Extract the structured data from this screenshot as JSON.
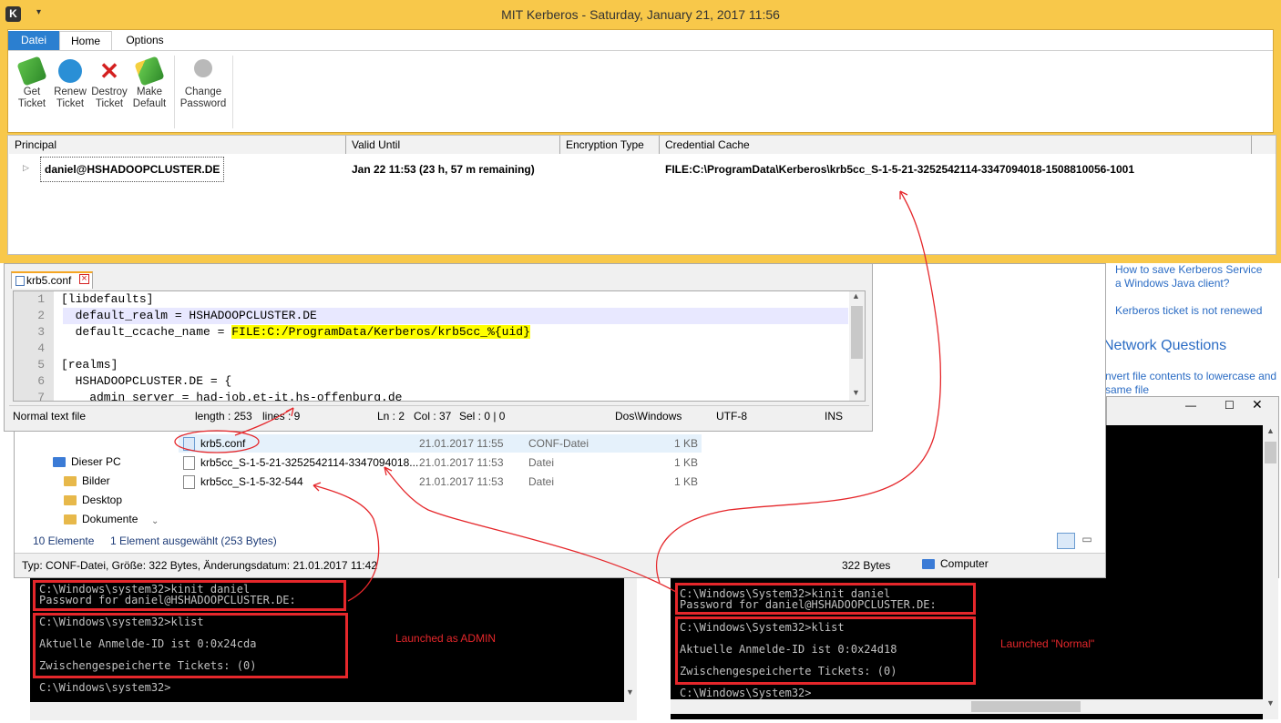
{
  "kerberos": {
    "title": "MIT Kerberos - Saturday, January 21, 2017  11:56",
    "tabs": [
      "Datei",
      "Home",
      "Options"
    ],
    "buttons": [
      {
        "label1": "Get",
        "label2": "Ticket",
        "icon": "green-ticket-icon"
      },
      {
        "label1": "Renew",
        "label2": "Ticket",
        "icon": "renew-icon"
      },
      {
        "label1": "Destroy",
        "label2": "Ticket",
        "icon": "red-x-icon"
      },
      {
        "label1": "Make",
        "label2": "Default",
        "icon": "star-ticket-icon"
      },
      {
        "label1": "Change",
        "label2": "Password",
        "icon": "keys-icon"
      }
    ],
    "columns": [
      "Principal",
      "Valid Until",
      "Encryption Type",
      "Credential Cache"
    ],
    "row": {
      "principal": "daniel@HSHADOOPCLUSTER.DE",
      "valid_until": "Jan 22  11:53 (23 h, 57 m remaining)",
      "encryption_type": "",
      "credential_cache": "FILE:C:\\ProgramData\\Kerberos\\krb5cc_S-1-5-21-3252542114-3347094018-1508810056-1001"
    }
  },
  "side_links": {
    "link1a": "How to save Kerberos Service",
    "link1b": "a Windows Java client?",
    "link2": "Kerberos ticket is not renewed",
    "heading": "Network Questions",
    "link3a": "nvert file contents to lowercase and",
    "link3b": "same file"
  },
  "notepad": {
    "tab": "krb5.conf",
    "lines": [
      {
        "no": "1",
        "text": "[libdefaults]"
      },
      {
        "no": "2",
        "text": "  default_realm = HSHADOOPCLUSTER.DE"
      },
      {
        "no": "3",
        "text": "  default_ccache_name = ",
        "hl": "FILE:C:/ProgramData/Kerberos/krb5cc_%{uid}"
      },
      {
        "no": "4",
        "text": ""
      },
      {
        "no": "5",
        "text": "[realms]"
      },
      {
        "no": "6",
        "text": "  HSHADOOPCLUSTER.DE = {"
      },
      {
        "no": "7",
        "text": "    admin_server = had-job.et-it.hs-offenburg.de"
      }
    ],
    "status": {
      "type": "Normal text file",
      "length": "length : 253",
      "lines": "lines : 9",
      "ln": "Ln : 2",
      "col": "Col : 37",
      "sel": "Sel : 0 | 0",
      "eol": "Dos\\Windows",
      "enc": "UTF-8",
      "ins": "INS"
    }
  },
  "explorer": {
    "tree": [
      "Dieser PC",
      "Bilder",
      "Desktop",
      "Dokumente"
    ],
    "files": [
      {
        "name": "krb5.conf",
        "date": "21.01.2017 11:55",
        "type": "CONF-Datei",
        "size": "1 KB"
      },
      {
        "name": "krb5cc_S-1-5-21-3252542114-3347094018...",
        "date": "21.01.2017 11:53",
        "type": "Datei",
        "size": "1 KB"
      },
      {
        "name": "krb5cc_S-1-5-32-544",
        "date": "21.01.2017 11:53",
        "type": "Datei",
        "size": "1 KB"
      }
    ],
    "count": "10 Elemente",
    "selected": "1 Element ausgewählt (253 Bytes)",
    "statusbar": "Typ: CONF-Datei, Größe: 322 Bytes, Änderungsdatum: 21.01.2017 11:42",
    "bytes": "322 Bytes",
    "computer": "Computer"
  },
  "console_admin": {
    "l1": "C:\\Windows\\system32>kinit daniel",
    "l2": "Password for daniel@HSHADOOPCLUSTER.DE:",
    "l3": "C:\\Windows\\system32>klist",
    "l4": "Aktuelle Anmelde-ID ist 0:0x24cda",
    "l5": "Zwischengespeicherte Tickets: (0)",
    "l6": "C:\\Windows\\system32>",
    "annotation": "Launched as ADMIN"
  },
  "console_normal": {
    "l1": "C:\\Windows\\System32>kinit daniel",
    "l2": "Password for daniel@HSHADOOPCLUSTER.DE:",
    "l3": "C:\\Windows\\System32>klist",
    "l4": "Aktuelle Anmelde-ID ist 0:0x24d18",
    "l5": "Zwischengespeicherte Tickets: (0)",
    "l6": "C:\\Windows\\System32>",
    "annotation": "Launched \"Normal\""
  },
  "colors": {
    "kerberos_frame": "#f8c84a",
    "ribbon_tab": "#2b7fd0",
    "annotation_red": "#e5272b",
    "highlight": "#ffff00",
    "console_bg": "#000000",
    "link_blue": "#2b6cc4"
  }
}
